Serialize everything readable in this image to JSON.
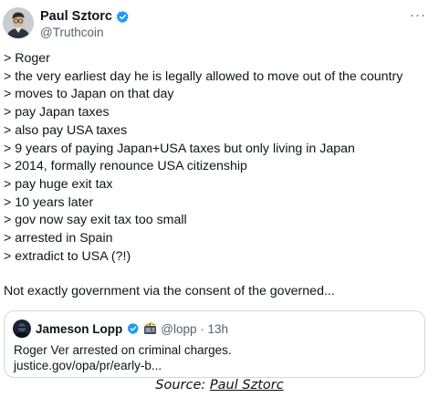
{
  "tweet": {
    "author_name": "Paul Sztorc",
    "author_handle": "@Truthcoin",
    "more_label": "···",
    "lines": [
      "> Roger",
      "> the very earliest day he is legally allowed to move out of the country",
      "> moves to Japan on that day",
      "> pay Japan taxes",
      "> also pay USA taxes",
      "> 9 years of paying Japan+USA taxes but only living in Japan",
      "> 2014, formally renounce USA citizenship",
      "> pay huge exit tax",
      "> 10 years later",
      "> gov now say exit tax too small",
      "> arrested in Spain",
      "> extradict to USA (?!)"
    ],
    "closing": "Not exactly government via the consent of the governed...",
    "colors": {
      "verified": "#1d9bf0",
      "text": "#0f1419",
      "secondary": "#536471",
      "border": "#cfd9de"
    }
  },
  "quote": {
    "author_name": "Jameson Lopp",
    "handle_time": "@lopp · 13h",
    "text_line1": "Roger Ver arrested on criminal charges.",
    "text_line2": "justice.gov/opa/pr/early-b..."
  },
  "caption": {
    "prefix": "Source: ",
    "link_text": "Paul Sztorc"
  }
}
